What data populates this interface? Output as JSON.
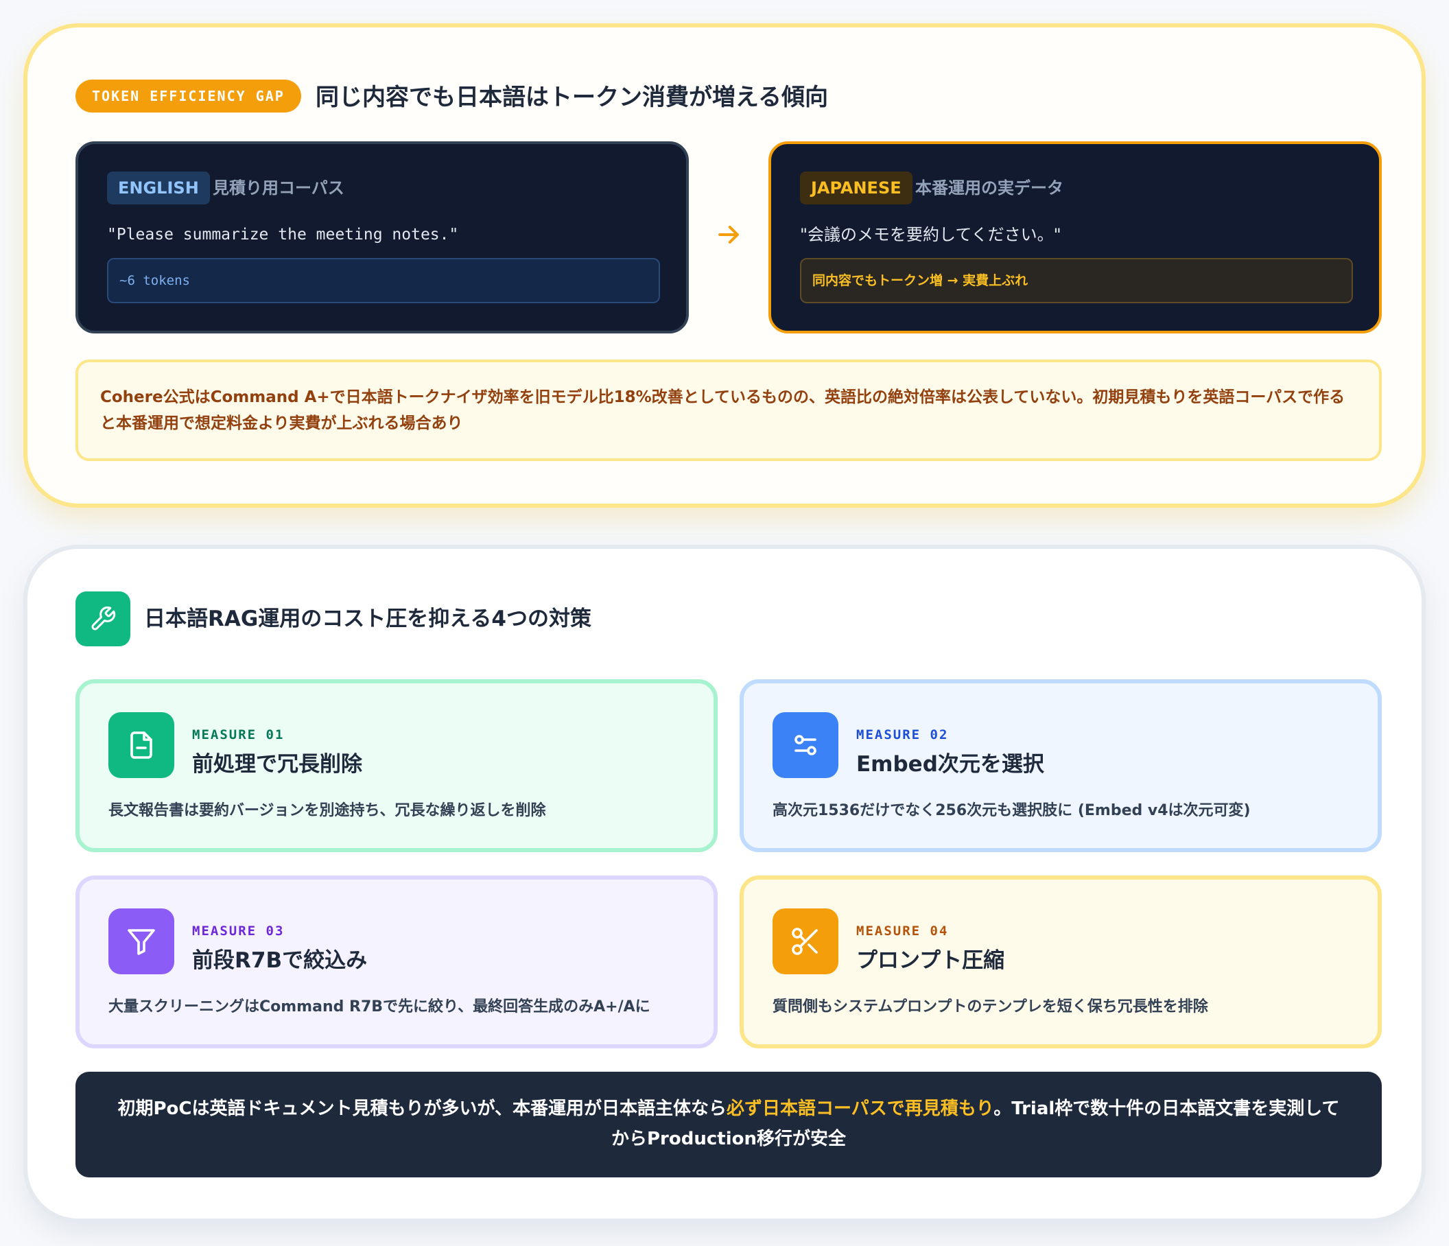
{
  "gap": {
    "tag": "TOKEN EFFICIENCY GAP",
    "headline": "同じ内容でも日本語はトークン消費が増える傾向",
    "english": {
      "badge": "ENGLISH",
      "subtitle": "見積り用コーパス",
      "quote": "\"Please summarize the meeting notes.\"",
      "result": "~6 tokens"
    },
    "japanese": {
      "badge": "JAPANESE",
      "subtitle": "本番運用の実データ",
      "quote": "\"会議のメモを要約してください。\"",
      "result": "同内容でもトークン増 → 実費上ぶれ"
    },
    "note": "Cohere公式はCommand A+で日本語トークナイザ効率を旧モデル比18%改善としているものの、英語比の絶対倍率は公表していない。初期見積もりを英語コーパスで作ると本番運用で想定料金より実費が上ぶれる場合あり"
  },
  "measures": {
    "headline": "日本語RAG運用のコスト圧を抑える4つの対策",
    "items": [
      {
        "label": "MEASURE 01",
        "title": "前処理で冗長削除",
        "desc": "長文報告書は要約バージョンを別途持ち、冗長な繰り返しを削除",
        "icon": "file-minus-icon"
      },
      {
        "label": "MEASURE 02",
        "title": "Embed次元を選択",
        "desc": "高次元1536だけでなく256次元も選択肢に (Embed v4は次元可変)",
        "icon": "sliders-icon"
      },
      {
        "label": "MEASURE 03",
        "title": "前段R7Bで絞込み",
        "desc": "大量スクリーニングはCommand R7Bで先に絞り、最終回答生成のみA+/Aに",
        "icon": "filter-icon"
      },
      {
        "label": "MEASURE 04",
        "title": "プロンプト圧縮",
        "desc": "質問側もシステムプロンプトのテンプレを短く保ち冗長性を排除",
        "icon": "scissors-icon"
      }
    ],
    "footer": {
      "before": "初期PoCは英語ドキュメント見積もりが多いが、本番運用が日本語主体なら",
      "highlight": "必ず日本語コーパスで再見積もり",
      "after": "。Trial枠で数十件の日本語文書を実測してからProduction移行が安全"
    }
  },
  "colors": {
    "accent_amber": "#f59e0b",
    "accent_green": "#10b981",
    "accent_blue": "#3b82f6",
    "accent_purple": "#8b5cf6",
    "dark_panel": "#111a2e",
    "footer_bg": "#1e293b",
    "highlight_text": "#fbbf24"
  }
}
